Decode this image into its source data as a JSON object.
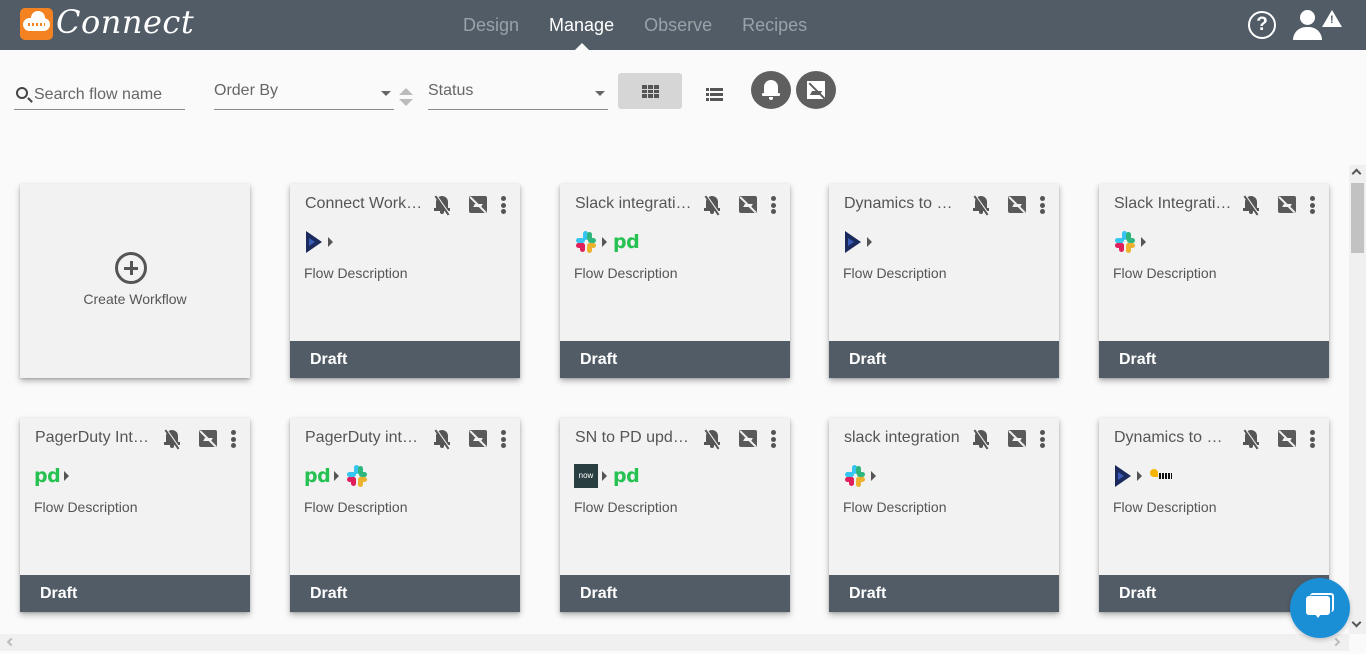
{
  "app": {
    "brand": "Connect",
    "accent_color": "#f58220",
    "header_bg": "#525c66"
  },
  "nav": {
    "items": [
      {
        "label": "Design",
        "active": false
      },
      {
        "label": "Manage",
        "active": true
      },
      {
        "label": "Observe",
        "active": false
      },
      {
        "label": "Recipes",
        "active": false
      }
    ]
  },
  "header_icons": {
    "help": "?",
    "warning": "!"
  },
  "toolbar": {
    "search_placeholder": "Search flow name",
    "search_value": "",
    "order_by_label": "Order By",
    "status_label": "Status",
    "view_mode": "grid"
  },
  "create_card": {
    "label": "Create Workflow"
  },
  "flows": [
    {
      "title": "Connect Workflow",
      "display_title": "Connect Work…",
      "logos": [
        "dynamics"
      ],
      "description": "Flow Description",
      "status": "Draft"
    },
    {
      "title": "Slack integration",
      "display_title": "Slack integration",
      "logos": [
        "slack",
        "pagerduty"
      ],
      "description": "Flow Description",
      "status": "Draft"
    },
    {
      "title": "Dynamics to S…",
      "display_title": "Dynamics to S…",
      "logos": [
        "dynamics"
      ],
      "description": "Flow Description",
      "status": "Draft"
    },
    {
      "title": "Slack Integration",
      "display_title": "Slack Integration",
      "logos": [
        "slack"
      ],
      "description": "Flow Description",
      "status": "Draft"
    },
    {
      "title": "PagerDuty Int…",
      "display_title": "PagerDuty Int…",
      "logos": [
        "pagerduty"
      ],
      "description": "Flow Description",
      "status": "Draft"
    },
    {
      "title": "PagerDuty int…",
      "display_title": "PagerDuty int…",
      "logos": [
        "pagerduty",
        "slack"
      ],
      "description": "Flow Description",
      "status": "Draft"
    },
    {
      "title": "SN to PD upd…",
      "display_title": "SN to PD upd…",
      "logos": [
        "servicenow",
        "pagerduty"
      ],
      "description": "Flow Description",
      "status": "Draft"
    },
    {
      "title": "slack integration",
      "display_title": "slack integration",
      "logos": [
        "slack"
      ],
      "description": "Flow Description",
      "status": "Draft"
    },
    {
      "title": "Dynamics to U…",
      "display_title": "Dynamics to U…",
      "logos": [
        "dynamics",
        "unknown-service"
      ],
      "description": "Flow Description",
      "status": "Draft"
    }
  ],
  "logo_text": {
    "pagerduty": "pd",
    "servicenow": "now"
  }
}
